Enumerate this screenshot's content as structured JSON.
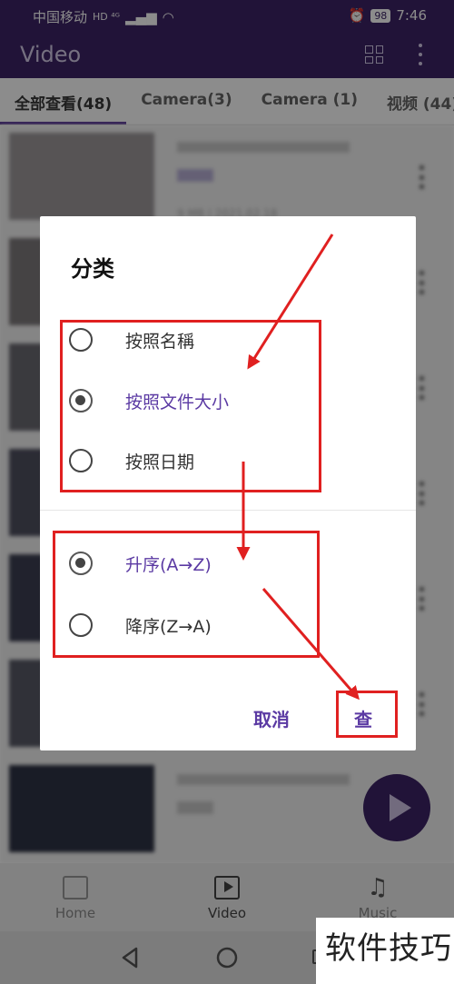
{
  "status_bar": {
    "carrier": "中国移动",
    "signal_tags": "HD ⁴ᴳ",
    "battery": "98",
    "time": "7:46"
  },
  "app_bar": {
    "title": "Video"
  },
  "tabs": [
    {
      "label": "全部查看(48)",
      "active": true
    },
    {
      "label": "Camera(3)",
      "active": false
    },
    {
      "label": "Camera (1)",
      "active": false
    },
    {
      "label": "视频 (44)",
      "active": false
    }
  ],
  "list": {
    "first_meta": "9 MB | 2021.02.18"
  },
  "dialog": {
    "title": "分类",
    "sort_by_options": [
      {
        "label": "按照名稱",
        "checked": false
      },
      {
        "label": "按照文件大小",
        "checked": true
      },
      {
        "label": "按照日期",
        "checked": false
      }
    ],
    "order_options": [
      {
        "label": "升序(A→Z)",
        "checked": true
      },
      {
        "label": "降序(Z→A)",
        "checked": false
      }
    ],
    "cancel_label": "取消",
    "confirm_label": "查"
  },
  "bottom_nav": {
    "items": [
      {
        "label": "Home",
        "icon": "folder-icon"
      },
      {
        "label": "Video",
        "icon": "video-icon",
        "active": true
      },
      {
        "label": "Music",
        "icon": "music-icon"
      }
    ]
  },
  "watermark": "软件技巧",
  "colors": {
    "primary": "#3d2466",
    "accent": "#5b3aa3",
    "annotation": "#e02020"
  }
}
